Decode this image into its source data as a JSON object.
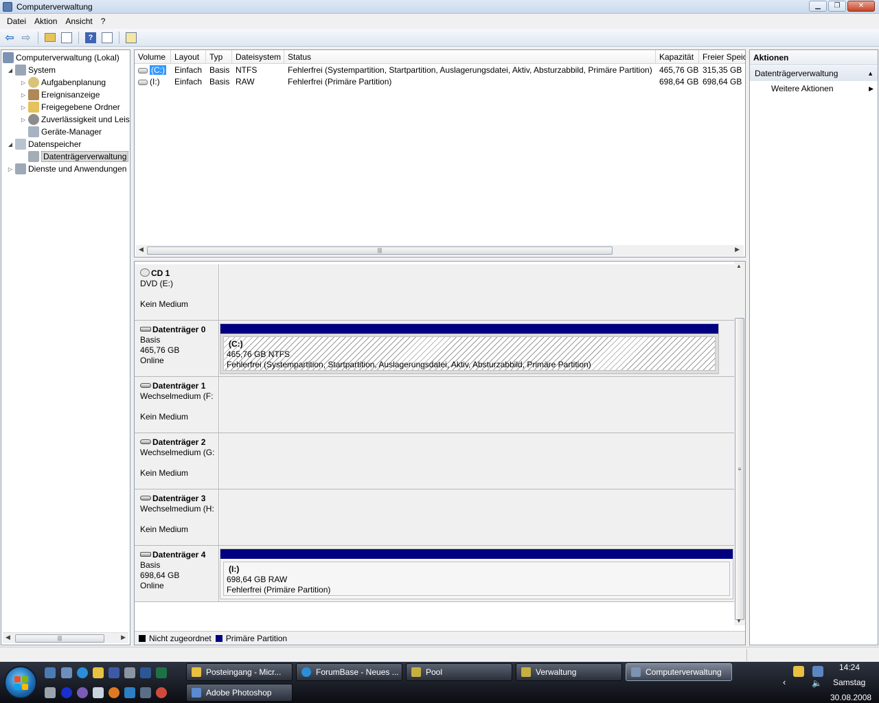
{
  "window": {
    "title": "Computerverwaltung"
  },
  "menu": [
    "Datei",
    "Aktion",
    "Ansicht",
    "?"
  ],
  "tree": {
    "items": [
      {
        "label": "Computerverwaltung (Lokal)",
        "level": 0,
        "expander": ""
      },
      {
        "label": "System",
        "level": 1,
        "expander": "◢"
      },
      {
        "label": "Aufgabenplanung",
        "level": 2,
        "expander": "▷"
      },
      {
        "label": "Ereignisanzeige",
        "level": 2,
        "expander": "▷"
      },
      {
        "label": "Freigegebene Ordner",
        "level": 2,
        "expander": "▷"
      },
      {
        "label": "Zuverlässigkeit und Leis",
        "level": 2,
        "expander": "▷"
      },
      {
        "label": "Geräte-Manager",
        "level": 2,
        "expander": ""
      },
      {
        "label": "Datenspeicher",
        "level": 1,
        "expander": "◢"
      },
      {
        "label": "Datenträgerverwaltung",
        "level": 2,
        "expander": "",
        "selected": true
      },
      {
        "label": "Dienste und Anwendungen",
        "level": 1,
        "expander": "▷"
      }
    ]
  },
  "volume_list": {
    "columns": [
      "Volume",
      "Layout",
      "Typ",
      "Dateisystem",
      "Status",
      "Kapazität",
      "Freier Speic"
    ],
    "rows": [
      {
        "volume": "(C:)",
        "layout": "Einfach",
        "typ": "Basis",
        "fs": "NTFS",
        "status": "Fehlerfrei (Systempartition, Startpartition, Auslagerungsdatei, Aktiv, Absturzabbild, Primäre Partition)",
        "capacity": "465,76 GB",
        "free": "315,35 GB"
      },
      {
        "volume": "(I:)",
        "layout": "Einfach",
        "typ": "Basis",
        "fs": "RAW",
        "status": "Fehlerfrei (Primäre Partition)",
        "capacity": "698,64 GB",
        "free": "698,64 GB"
      }
    ]
  },
  "disks": [
    {
      "name": "CD 1",
      "line1": "DVD (E:)",
      "line2": "",
      "line3": "Kein Medium",
      "icon": "cd-icon"
    },
    {
      "name": "Datenträger 0",
      "line1": "Basis",
      "line2": "465,76 GB",
      "line3": "Online",
      "icon": "disk-icon",
      "partition": {
        "name": "(C:)",
        "size": "465,76 GB NTFS",
        "status": "Fehlerfrei (Systempartition, Startpartition, Auslagerungsdatei, Aktiv, Absturzabbild, Primäre Partition)"
      }
    },
    {
      "name": "Datenträger 1",
      "line1": "Wechselmedium (F:",
      "line2": "",
      "line3": "Kein Medium",
      "icon": "removable-icon"
    },
    {
      "name": "Datenträger 2",
      "line1": "Wechselmedium (G:",
      "line2": "",
      "line3": "Kein Medium",
      "icon": "removable-icon"
    },
    {
      "name": "Datenträger 3",
      "line1": "Wechselmedium (H:",
      "line2": "",
      "line3": "Kein Medium",
      "icon": "removable-icon"
    },
    {
      "name": "Datenträger 4",
      "line1": "Basis",
      "line2": "698,64 GB",
      "line3": "Online",
      "icon": "disk-icon",
      "partition": {
        "name": "(I:)",
        "size": "698,64 GB RAW",
        "status": "Fehlerfrei (Primäre Partition)"
      }
    }
  ],
  "legend": {
    "unallocated": "Nicht zugeordnet",
    "primary": "Primäre Partition",
    "unallocated_color": "#000000",
    "primary_color": "#000080"
  },
  "actions": {
    "header": "Aktionen",
    "section": "Datenträgerverwaltung",
    "more": "Weitere Aktionen"
  },
  "taskbar": {
    "tasks": [
      {
        "label": "Posteingang - Micr..."
      },
      {
        "label": "ForumBase - Neues ..."
      },
      {
        "label": "Pool"
      },
      {
        "label": "Verwaltung"
      },
      {
        "label": "Computerverwaltung",
        "active": true
      },
      {
        "label": "Adobe Photoshop"
      }
    ],
    "time": "14:24",
    "day": "Samstag",
    "date": "30.08.2008"
  }
}
